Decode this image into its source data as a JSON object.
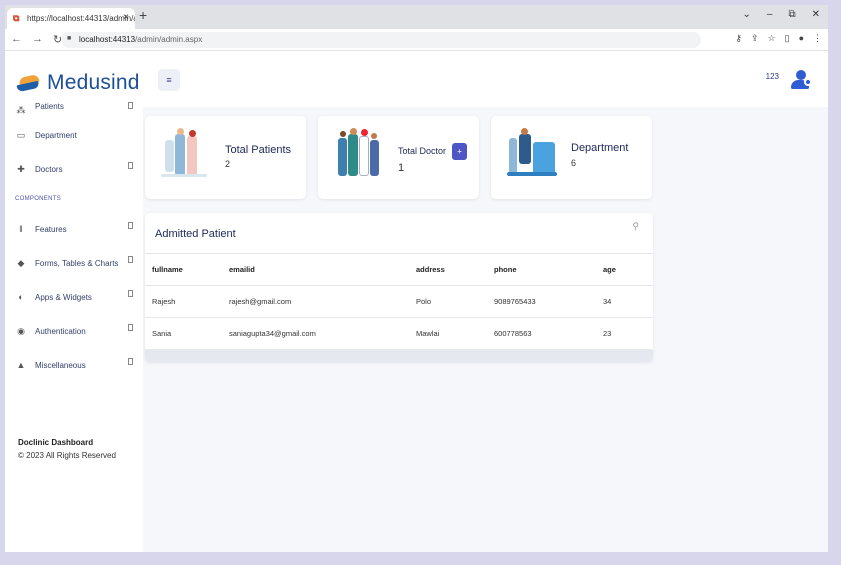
{
  "browser": {
    "tab_title": "https://localhost:44313/admin/a",
    "tab_close": "×",
    "new_tab": "+",
    "url_host": "localhost:44313",
    "url_path": "/admin/admin.aspx",
    "controls": {
      "chevron": "⌄",
      "minimize": "–",
      "restore": "⧉",
      "close": "✕"
    }
  },
  "brand": {
    "name": "Medusind"
  },
  "sidebar": {
    "items_top": [
      {
        "label": "Patients",
        "icon": "patients-icon"
      },
      {
        "label": "Department",
        "icon": "calendar-icon"
      },
      {
        "label": "Doctors",
        "icon": "medical-icon"
      }
    ],
    "section": "COMPONENTS",
    "items_components": [
      {
        "label": "Features",
        "icon": "books-icon"
      },
      {
        "label": "Forms, Tables & Charts",
        "icon": "cube-icon"
      },
      {
        "label": "Apps & Widgets",
        "icon": "planet-icon"
      },
      {
        "label": "Authentication",
        "icon": "dot-circle-icon"
      },
      {
        "label": "Miscellaneous",
        "icon": "warning-icon"
      }
    ],
    "footer_title": "Doclinic Dashboard",
    "footer_copy": "© 2023 All Rights Reserved"
  },
  "topbar": {
    "menu_icon": "≡",
    "user_number": "123"
  },
  "stats": [
    {
      "title": "Total Patients",
      "value": "2"
    },
    {
      "title": "Total Doctor",
      "value": "1",
      "action": "+"
    },
    {
      "title": "Department",
      "value": "6"
    }
  ],
  "admitted": {
    "title": "Admitted Patient",
    "columns": [
      "fullname",
      "emailid",
      "address",
      "phone",
      "age"
    ],
    "rows": [
      [
        "Rajesh",
        "rajesh@gmail.com",
        "Polo",
        "9089765433",
        "34"
      ],
      [
        "Sania",
        "saniagupta34@gmail.com",
        "Mawlai",
        "600778563",
        "23"
      ]
    ]
  },
  "colors": {
    "brand_blue": "#1d4f9a",
    "accent": "#5055c6",
    "brand_orange": "#f2a23b"
  }
}
